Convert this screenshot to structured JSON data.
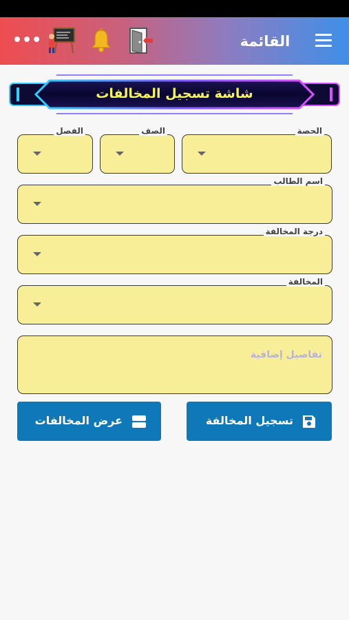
{
  "app_bar": {
    "title": "القائمة",
    "menu_icon": "hamburger-menu-icon",
    "more_icon": "more-dots-icon",
    "more_glyph": "•••",
    "teacher_icon": "teacher-board-icon",
    "bell_icon": "bell-icon",
    "exit_icon": "exit-door-icon",
    "gradient": [
      "#ee4d4f",
      "#3f8fe8"
    ]
  },
  "banner": {
    "title": "شاشة تسجيل المخالفات"
  },
  "form": {
    "period": {
      "label": "الحصة",
      "value": ""
    },
    "grade": {
      "label": "الصف",
      "value": ""
    },
    "class": {
      "label": "الفصل",
      "value": ""
    },
    "student_name": {
      "label": "اسم الطالب",
      "value": ""
    },
    "violation_degree": {
      "label": "درجة المخالفة",
      "value": ""
    },
    "violation": {
      "label": "المخالفة",
      "value": ""
    },
    "details": {
      "placeholder": "تفاصيل إضافية",
      "value": ""
    }
  },
  "buttons": {
    "register": {
      "label": "تسجيل المخالفة",
      "icon": "save-icon"
    },
    "view": {
      "label": "عرض المخالفات",
      "icon": "list-icon"
    }
  },
  "colors": {
    "field_bg": "#f9ee98",
    "button_bg": "#0f78b8",
    "banner_text": "#f6f35a"
  }
}
